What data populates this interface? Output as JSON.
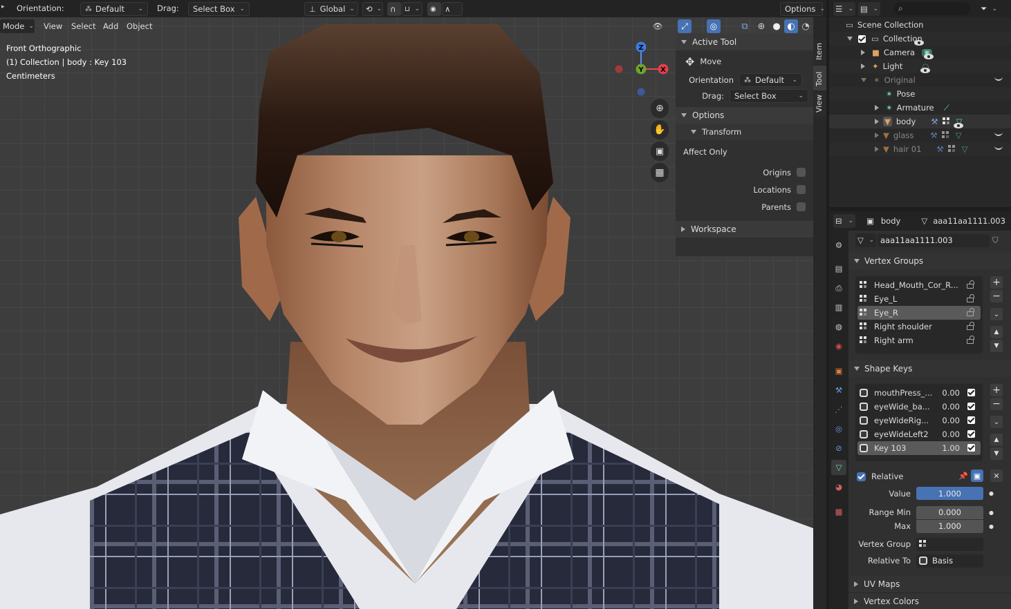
{
  "header": {
    "orientation_label": "Orientation:",
    "orientation_value": "Default",
    "drag_label": "Drag:",
    "drag_value": "Select Box",
    "transform_space": "Global",
    "options": "Options"
  },
  "viewport_menu": [
    "Mode",
    "View",
    "Select",
    "Add",
    "Object"
  ],
  "viewport_info": {
    "view": "Front Orthographic",
    "context": "(1) Collection | body : Key 103",
    "units": "Centimeters"
  },
  "gizmo": {
    "z": "Z",
    "y": "Y",
    "x": "X"
  },
  "sidebar_tabs": [
    "Item",
    "Tool",
    "View"
  ],
  "tool_panel": {
    "active_tool_header": "Active Tool",
    "move": "Move",
    "orientation_label": "Orientation",
    "orientation_value": "Default",
    "drag_label": "Drag:",
    "drag_value": "Select Box",
    "options_header": "Options",
    "transform_header": "Transform",
    "affect_only": "Affect Only",
    "origins": "Origins",
    "locations": "Locations",
    "parents": "Parents",
    "workspace_header": "Workspace"
  },
  "outliner": {
    "scene_collection": "Scene Collection",
    "items": [
      {
        "label": "Collection"
      },
      {
        "label": "Camera"
      },
      {
        "label": "Light"
      },
      {
        "label": "Original"
      },
      {
        "label": "Pose"
      },
      {
        "label": "Armature"
      },
      {
        "label": "body"
      },
      {
        "label": "glass"
      },
      {
        "label": "hair 01"
      }
    ]
  },
  "properties": {
    "object_name": "body",
    "mesh_name": "aaa11aa1111.003",
    "data_name": "aaa11aa1111.003",
    "vertex_groups_header": "Vertex Groups",
    "vertex_groups": [
      "Head_Mouth_Cor_R...",
      "Eye_L",
      "Eye_R",
      "Right shoulder",
      "Right arm"
    ],
    "selected_vertex_group": 2,
    "shape_keys_header": "Shape Keys",
    "shape_keys": [
      {
        "name": "mouthPress_...",
        "value": "0.00"
      },
      {
        "name": "eyeWide_ba...",
        "value": "0.00"
      },
      {
        "name": "eyeWideRig...",
        "value": "0.00"
      },
      {
        "name": "eyeWideLeft2",
        "value": "0.00"
      },
      {
        "name": "Key 103",
        "value": "1.00"
      }
    ],
    "relative_label": "Relative",
    "value_label": "Value",
    "value": "1.000",
    "range_min_label": "Range Min",
    "range_min": "0.000",
    "max_label": "Max",
    "max": "1.000",
    "vertex_group_label": "Vertex Group",
    "relative_to_label": "Relative To",
    "relative_to": "Basis",
    "uv_maps_header": "UV Maps",
    "vertex_colors_header": "Vertex Colors"
  },
  "colors": {
    "accent": "#4772b3",
    "viewport_bg": "#3d3d3d",
    "panel_bg": "#303030",
    "header_bg": "#232323"
  }
}
